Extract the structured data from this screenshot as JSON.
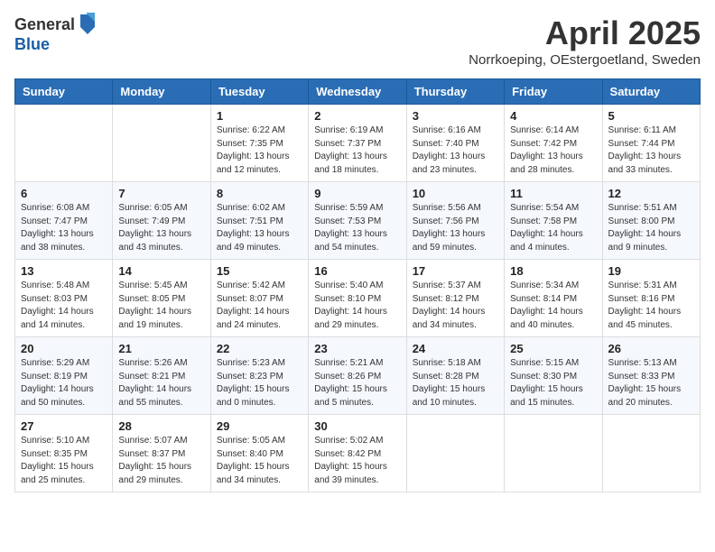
{
  "logo": {
    "general": "General",
    "blue": "Blue"
  },
  "title": "April 2025",
  "subtitle": "Norrkoeping, OEstergoetland, Sweden",
  "weekdays": [
    "Sunday",
    "Monday",
    "Tuesday",
    "Wednesday",
    "Thursday",
    "Friday",
    "Saturday"
  ],
  "weeks": [
    [
      {
        "day": "",
        "info": ""
      },
      {
        "day": "",
        "info": ""
      },
      {
        "day": "1",
        "info": "Sunrise: 6:22 AM\nSunset: 7:35 PM\nDaylight: 13 hours and 12 minutes."
      },
      {
        "day": "2",
        "info": "Sunrise: 6:19 AM\nSunset: 7:37 PM\nDaylight: 13 hours and 18 minutes."
      },
      {
        "day": "3",
        "info": "Sunrise: 6:16 AM\nSunset: 7:40 PM\nDaylight: 13 hours and 23 minutes."
      },
      {
        "day": "4",
        "info": "Sunrise: 6:14 AM\nSunset: 7:42 PM\nDaylight: 13 hours and 28 minutes."
      },
      {
        "day": "5",
        "info": "Sunrise: 6:11 AM\nSunset: 7:44 PM\nDaylight: 13 hours and 33 minutes."
      }
    ],
    [
      {
        "day": "6",
        "info": "Sunrise: 6:08 AM\nSunset: 7:47 PM\nDaylight: 13 hours and 38 minutes."
      },
      {
        "day": "7",
        "info": "Sunrise: 6:05 AM\nSunset: 7:49 PM\nDaylight: 13 hours and 43 minutes."
      },
      {
        "day": "8",
        "info": "Sunrise: 6:02 AM\nSunset: 7:51 PM\nDaylight: 13 hours and 49 minutes."
      },
      {
        "day": "9",
        "info": "Sunrise: 5:59 AM\nSunset: 7:53 PM\nDaylight: 13 hours and 54 minutes."
      },
      {
        "day": "10",
        "info": "Sunrise: 5:56 AM\nSunset: 7:56 PM\nDaylight: 13 hours and 59 minutes."
      },
      {
        "day": "11",
        "info": "Sunrise: 5:54 AM\nSunset: 7:58 PM\nDaylight: 14 hours and 4 minutes."
      },
      {
        "day": "12",
        "info": "Sunrise: 5:51 AM\nSunset: 8:00 PM\nDaylight: 14 hours and 9 minutes."
      }
    ],
    [
      {
        "day": "13",
        "info": "Sunrise: 5:48 AM\nSunset: 8:03 PM\nDaylight: 14 hours and 14 minutes."
      },
      {
        "day": "14",
        "info": "Sunrise: 5:45 AM\nSunset: 8:05 PM\nDaylight: 14 hours and 19 minutes."
      },
      {
        "day": "15",
        "info": "Sunrise: 5:42 AM\nSunset: 8:07 PM\nDaylight: 14 hours and 24 minutes."
      },
      {
        "day": "16",
        "info": "Sunrise: 5:40 AM\nSunset: 8:10 PM\nDaylight: 14 hours and 29 minutes."
      },
      {
        "day": "17",
        "info": "Sunrise: 5:37 AM\nSunset: 8:12 PM\nDaylight: 14 hours and 34 minutes."
      },
      {
        "day": "18",
        "info": "Sunrise: 5:34 AM\nSunset: 8:14 PM\nDaylight: 14 hours and 40 minutes."
      },
      {
        "day": "19",
        "info": "Sunrise: 5:31 AM\nSunset: 8:16 PM\nDaylight: 14 hours and 45 minutes."
      }
    ],
    [
      {
        "day": "20",
        "info": "Sunrise: 5:29 AM\nSunset: 8:19 PM\nDaylight: 14 hours and 50 minutes."
      },
      {
        "day": "21",
        "info": "Sunrise: 5:26 AM\nSunset: 8:21 PM\nDaylight: 14 hours and 55 minutes."
      },
      {
        "day": "22",
        "info": "Sunrise: 5:23 AM\nSunset: 8:23 PM\nDaylight: 15 hours and 0 minutes."
      },
      {
        "day": "23",
        "info": "Sunrise: 5:21 AM\nSunset: 8:26 PM\nDaylight: 15 hours and 5 minutes."
      },
      {
        "day": "24",
        "info": "Sunrise: 5:18 AM\nSunset: 8:28 PM\nDaylight: 15 hours and 10 minutes."
      },
      {
        "day": "25",
        "info": "Sunrise: 5:15 AM\nSunset: 8:30 PM\nDaylight: 15 hours and 15 minutes."
      },
      {
        "day": "26",
        "info": "Sunrise: 5:13 AM\nSunset: 8:33 PM\nDaylight: 15 hours and 20 minutes."
      }
    ],
    [
      {
        "day": "27",
        "info": "Sunrise: 5:10 AM\nSunset: 8:35 PM\nDaylight: 15 hours and 25 minutes."
      },
      {
        "day": "28",
        "info": "Sunrise: 5:07 AM\nSunset: 8:37 PM\nDaylight: 15 hours and 29 minutes."
      },
      {
        "day": "29",
        "info": "Sunrise: 5:05 AM\nSunset: 8:40 PM\nDaylight: 15 hours and 34 minutes."
      },
      {
        "day": "30",
        "info": "Sunrise: 5:02 AM\nSunset: 8:42 PM\nDaylight: 15 hours and 39 minutes."
      },
      {
        "day": "",
        "info": ""
      },
      {
        "day": "",
        "info": ""
      },
      {
        "day": "",
        "info": ""
      }
    ]
  ]
}
